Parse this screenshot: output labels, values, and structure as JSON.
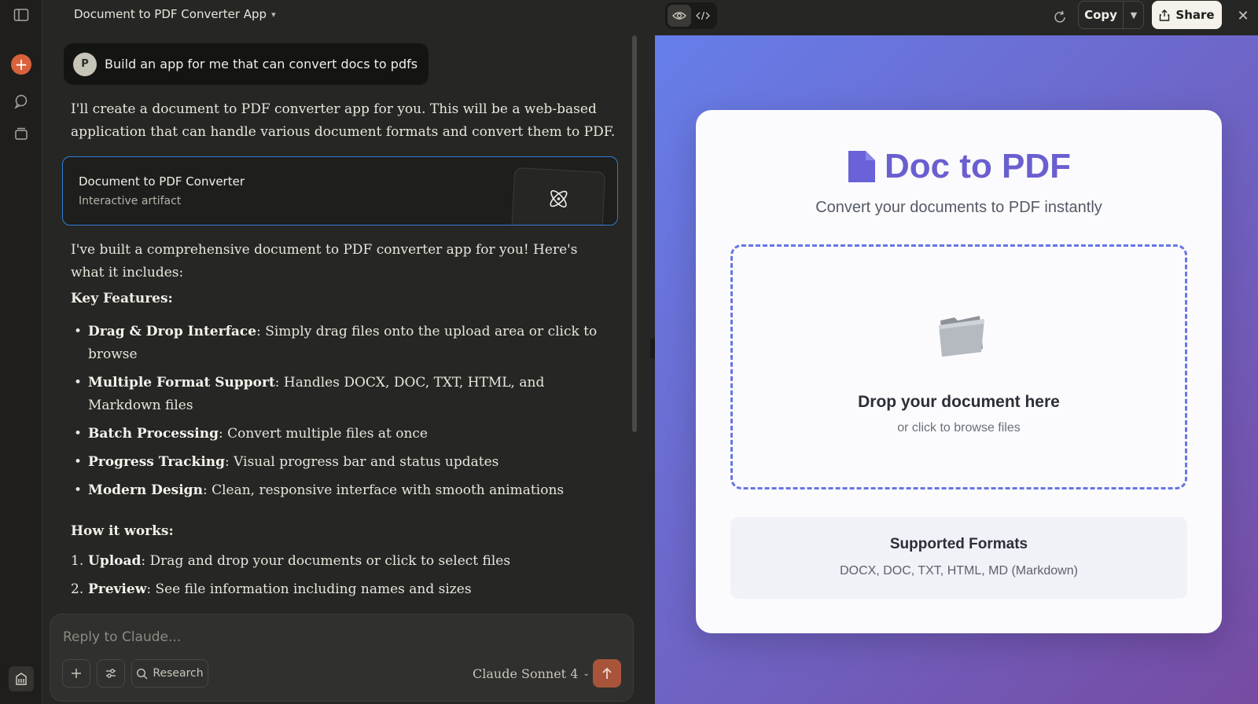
{
  "chat": {
    "title": "Document to PDF Converter App",
    "user_avatar": "P",
    "user_message": "Build an app for me that can convert docs to pdfs",
    "intro": "I'll create a document to PDF converter app for you. This will be a web-based application that can handle various document formats and convert them to PDF.",
    "artifact": {
      "title": "Document to PDF Converter",
      "subtitle": "Interactive artifact",
      "icon": "atom-icon"
    },
    "summary": "I've built a comprehensive document to PDF converter app for you! Here's what it includes:",
    "features_heading": "Key Features:",
    "features": [
      {
        "name": "Drag & Drop Interface",
        "desc": ": Simply drag files onto the upload area or click to browse"
      },
      {
        "name": "Multiple Format Support",
        "desc": ": Handles DOCX, DOC, TXT, HTML, and Markdown files"
      },
      {
        "name": "Batch Processing",
        "desc": ": Convert multiple files at once"
      },
      {
        "name": "Progress Tracking",
        "desc": ": Visual progress bar and status updates"
      },
      {
        "name": "Modern Design",
        "desc": ": Clean, responsive interface with smooth animations"
      }
    ],
    "how_heading": "How it works:",
    "steps": [
      {
        "num": "1.",
        "name": "Upload",
        "desc": ": Drag and drop your documents or click to select files"
      },
      {
        "num": "2.",
        "name": "Preview",
        "desc": ": See file information including names and sizes"
      }
    ]
  },
  "composer": {
    "placeholder": "Reply to Claude...",
    "research_label": "Research",
    "model": "Claude Sonnet 4"
  },
  "artifact_toolbar": {
    "copy_label": "Copy",
    "share_label": "Share"
  },
  "preview": {
    "title": "Doc to PDF",
    "subtitle": "Convert your documents to PDF instantly",
    "drop_title": "Drop your document here",
    "drop_sub": "or click to browse files",
    "formats_title": "Supported Formats",
    "formats_list": "DOCX, DOC, TXT, HTML, MD (Markdown)"
  },
  "colors": {
    "accent": "#d9623d",
    "artifact_border": "#2f7fd6",
    "gradient_start": "#667eea",
    "gradient_end": "#764ba2",
    "brand_purple": "#6a5fcf"
  }
}
